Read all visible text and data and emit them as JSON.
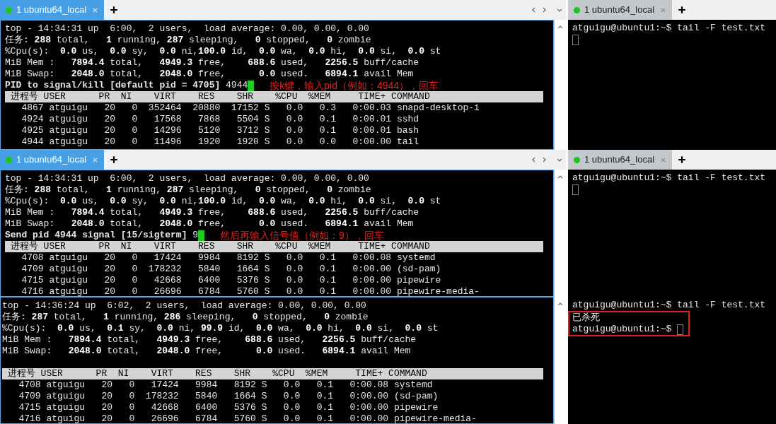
{
  "panels": [
    {
      "left": {
        "focused": true,
        "tab": {
          "label": "1 ubuntu64_local",
          "selected": true
        },
        "lines": [
          "top - 14:34:31 up  6:00,  2 users,  load average: 0.00, 0.00, 0.00",
          "任务: **288** total,   **1** running, **287** sleeping,   **0** stopped,   **0** zombie",
          "%Cpu(s):  **0.0** us,  **0.0** sy,  **0.0** ni,**100.0** id,  **0.0** wa,  **0.0** hi,  **0.0** si,  **0.0** st",
          "MiB Mem :   **7894.4** total,   **4949.3** free,    **688.6** used,   **2256.5** buff/cache",
          "MiB Swap:   **2048.0** total,   **2048.0** free,      **0.0** used.   **6894.1** avail Mem"
        ],
        "prompt": {
          "text": "PID to signal/kill [default pid = 4705]",
          "input": "4944",
          "cursor": true
        },
        "note": "按k键，输入pid（例如：4944），回车",
        "header": " 进程号 USER      PR  NI    VIRT    RES    SHR    %CPU  %MEM     TIME+ COMMAND",
        "rows": [
          "   4867 atguigu   20   0  352464  20880  17152 S   0.0   0.3   0:00.03 snapd-desktop-i",
          "   4924 atguigu   20   0   17568   7868   5504 S   0.0   0.1   0:00.01 sshd",
          "   4925 atguigu   20   0   14296   5120   3712 S   0.0   0.1   0:00.01 bash",
          "   4944 atguigu   20   0   11496   1920   1920 S   0.0   0.0   0:00.00 tail"
        ]
      },
      "right": {
        "focused": false,
        "tab": {
          "label": "1 ubuntu64_local",
          "selected": false
        },
        "lines": [
          {
            "text": "atguigu@ubuntu1:~$ tail -F test.txt",
            "cursor": false,
            "boxed": false
          },
          {
            "cursor": true,
            "boxed": false
          }
        ]
      }
    },
    {
      "left": {
        "focused": true,
        "tab": {
          "label": "1 ubuntu64_local",
          "selected": true
        },
        "lines": [
          "top - 14:34:31 up  6:00,  2 users,  load average: 0.00, 0.00, 0.00",
          "任务: **288** total,   **1** running, **287** sleeping,   **0** stopped,   **0** zombie",
          "%Cpu(s):  **0.0** us,  **0.0** sy,  **0.0** ni,**100.0** id,  **0.0** wa,  **0.0** hi,  **0.0** si,  **0.0** st",
          "MiB Mem :   **7894.4** total,   **4949.3** free,    **688.6** used,   **2256.5** buff/cache",
          "MiB Swap:   **2048.0** total,   **2048.0** free,      **0.0** used.   **6894.1** avail Mem"
        ],
        "prompt": {
          "text": "Send pid 4944 signal [15/sigterm]",
          "input": "9",
          "cursor": true
        },
        "note": "然后再输入信号值（例如：9），回车",
        "header": " 进程号 USER      PR  NI    VIRT    RES    SHR    %CPU  %MEM     TIME+ COMMAND",
        "rows": [
          "   4708 atguigu   20   0   17424   9984   8192 S   0.0   0.1   0:00.08 systemd",
          "   4709 atguigu   20   0  178232   5840   1664 S   0.0   0.1   0:00.00 (sd-pam)",
          "   4715 atguigu   20   0   42668   6400   5376 S   0.0   0.1   0:00.00 pipewire",
          "   4716 atguigu   20   0   26696   6784   5760 S   0.0   0.1   0:00.00 pipewire-media-"
        ]
      },
      "right": {
        "focused": false,
        "tab": {
          "label": "1 ubuntu64_local",
          "selected": false
        },
        "lines": [
          {
            "text": "atguigu@ubuntu1:~$ tail -F test.txt",
            "cursor": false,
            "boxed": false
          },
          {
            "cursor": true,
            "boxed": false
          }
        ]
      }
    },
    {
      "left": {
        "focused": true,
        "lines": [
          "top - 14:36:24 up  6:02,  2 users,  load average: 0.00, 0.00, 0.00",
          "任务: **287** total,   **1** running, **286** sleeping,   **0** stopped,   **0** zombie",
          "%Cpu(s):  **0.0** us,  **0.1** sy,  **0.0** ni, **99.9** id,  **0.0** wa,  **0.0** hi,  **0.0** si,  **0.0** st",
          "MiB Mem :   **7894.4** total,   **4949.3** free,    **688.6** used,   **2256.5** buff/cache",
          "MiB Swap:   **2048.0** total,   **2048.0** free,      **0.0** used.   **6894.1** avail Mem"
        ],
        "header": " 进程号 USER      PR  NI    VIRT    RES    SHR    %CPU  %MEM     TIME+ COMMAND",
        "rows": [
          "   4708 atguigu   20   0   17424   9984   8192 S   0.0   0.1   0:00.08 systemd",
          "   4709 atguigu   20   0  178232   5840   1664 S   0.0   0.1   0:00.00 (sd-pam)",
          "   4715 atguigu   20   0   42668   6400   5376 S   0.0   0.1   0:00.00 pipewire",
          "   4716 atguigu   20   0   26696   6784   5760 S   0.0   0.1   0:00.00 pipewire-media-"
        ]
      },
      "right": {
        "focused": false,
        "lines": [
          {
            "text": "atguigu@ubuntu1:~$ tail -F test.txt",
            "cursor": false,
            "boxed": false
          },
          {
            "text": "已杀死",
            "cursor": false,
            "boxed": true
          },
          {
            "text": "atguigu@ubuntu1:~$",
            "cursor": true,
            "boxed": true
          }
        ]
      }
    }
  ]
}
